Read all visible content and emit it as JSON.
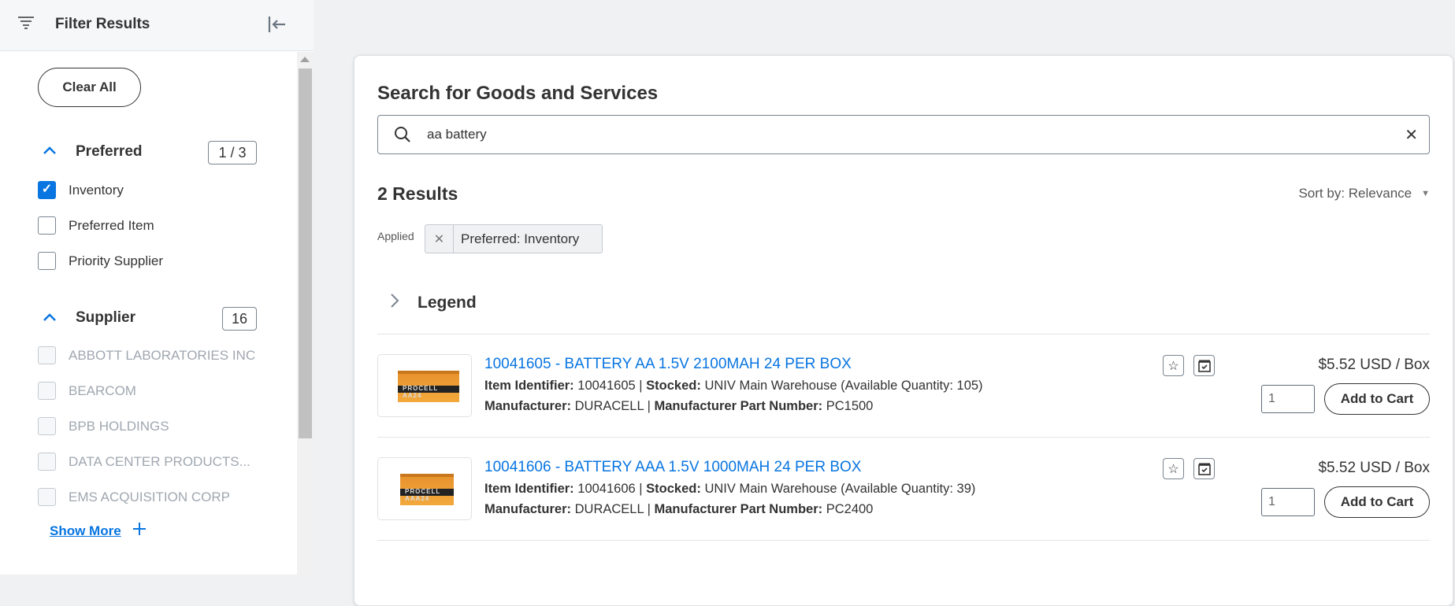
{
  "sidebar": {
    "title": "Filter Results",
    "clear_all": "Clear All",
    "preferred": {
      "label": "Preferred",
      "count": "1 / 3",
      "options": [
        {
          "label": "Inventory",
          "checked": true
        },
        {
          "label": "Preferred Item",
          "checked": false
        },
        {
          "label": "Priority Supplier",
          "checked": false
        }
      ]
    },
    "supplier": {
      "label": "Supplier",
      "count": "16",
      "options": [
        {
          "label": "ABBOTT LABORATORIES INC"
        },
        {
          "label": "BEARCOM"
        },
        {
          "label": "BPB HOLDINGS"
        },
        {
          "label": "DATA CENTER PRODUCTS..."
        },
        {
          "label": "EMS ACQUISITION CORP"
        }
      ]
    },
    "show_more": "Show More"
  },
  "main": {
    "title": "Search for Goods and Services",
    "search_value": "aa battery",
    "results_count": "2 Results",
    "sort_label": "Sort by: Relevance",
    "applied_label": "Applied",
    "applied_chip": "Preferred: Inventory",
    "legend": "Legend",
    "items": [
      {
        "title": "10041605 - BATTERY AA 1.5V 2100MAH 24 PER BOX",
        "id_label": "Item Identifier:",
        "id": "10041605",
        "stocked_label": "Stocked:",
        "stocked": "UNIV Main Warehouse (Available Quantity: 105)",
        "mfr_label": "Manufacturer:",
        "mfr": "DURACELL",
        "part_label": "Manufacturer Part Number:",
        "part": "PC1500",
        "price": "$5.52 USD / Box",
        "qty": "1",
        "add": "Add to Cart",
        "image_text": "PROCELL AA24"
      },
      {
        "title": "10041606 - BATTERY AAA 1.5V 1000MAH 24 PER BOX",
        "id_label": "Item Identifier:",
        "id": "10041606",
        "stocked_label": "Stocked:",
        "stocked": "UNIV Main Warehouse (Available Quantity: 39)",
        "mfr_label": "Manufacturer:",
        "mfr": "DURACELL",
        "part_label": "Manufacturer Part Number:",
        "part": "PC2400",
        "price": "$5.52 USD / Box",
        "qty": "1",
        "add": "Add to Cart",
        "image_text": "PROCELL AAA24"
      }
    ]
  },
  "colors": {
    "accent": "#0875e1",
    "text": "#333333",
    "background": "#f0f1f3"
  }
}
